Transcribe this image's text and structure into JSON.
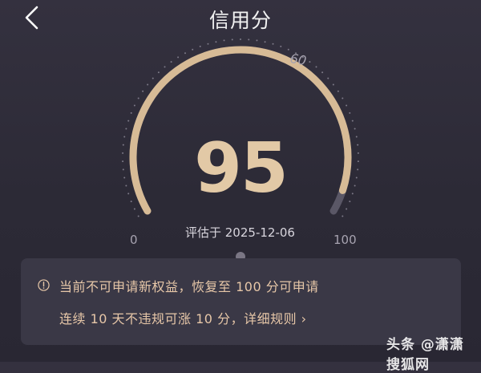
{
  "header": {
    "title": "信用分",
    "back_icon": "chevron-left-icon"
  },
  "gauge": {
    "score": "95",
    "value": 95,
    "min_label": "0",
    "max_label": "100",
    "marker_label": "60",
    "estimate_text": "评估于 2025-12-06",
    "colors": {
      "arc": "#d7bb96",
      "track": "#5a5766",
      "ticks": "#7d7a88"
    }
  },
  "notice": {
    "icon": "info-icon",
    "line1": "当前不可申请新权益，恢复至 100 分可申请",
    "line2": "连续 10 天不违规可涨 10 分，详细规则 ›"
  },
  "watermark": {
    "text": "头条 @潇潇 搜狐网"
  }
}
